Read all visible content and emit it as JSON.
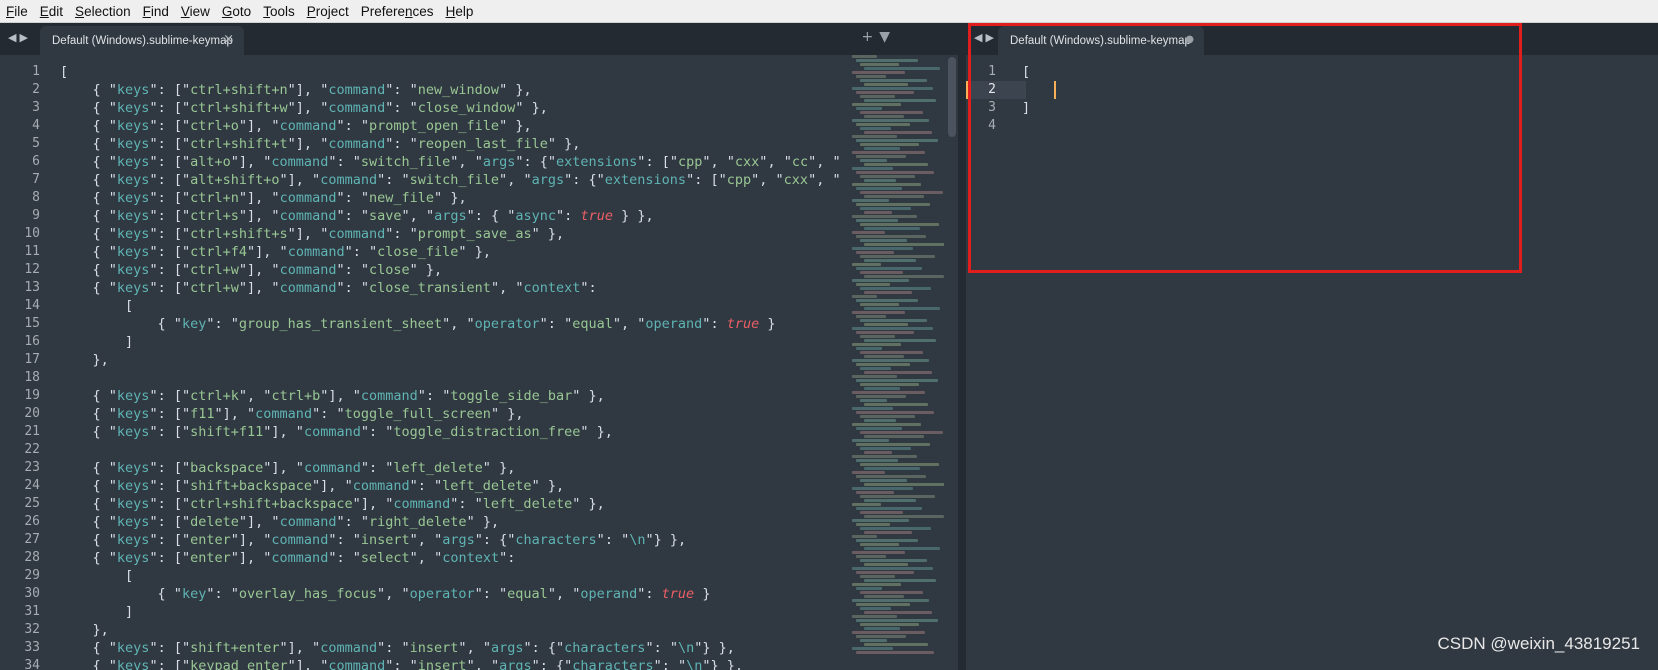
{
  "menu": [
    {
      "accel": "F",
      "rest": "ile"
    },
    {
      "accel": "E",
      "rest": "dit"
    },
    {
      "accel": "S",
      "rest": "election"
    },
    {
      "accel": "F",
      "rest": "ind"
    },
    {
      "accel": "V",
      "rest": "iew"
    },
    {
      "accel": "G",
      "rest": "oto"
    },
    {
      "accel": "T",
      "rest": "ools"
    },
    {
      "accel": "P",
      "rest": "roject"
    },
    {
      "pre": "Prefere",
      "accel": "n",
      "rest": "ces"
    },
    {
      "accel": "H",
      "rest": "elp"
    }
  ],
  "left_tab": {
    "label": "Default (Windows).sublime-keymap",
    "close": "×"
  },
  "right_tab": {
    "label": "Default (Windows).sublime-keymap",
    "dirty": "●"
  },
  "nav_arrows": "◀▶",
  "tab_tools": "+▼",
  "left_code": [
    "[",
    "\t{ \"keys\": [\"ctrl+shift+n\"], \"command\": \"new_window\" },",
    "\t{ \"keys\": [\"ctrl+shift+w\"], \"command\": \"close_window\" },",
    "\t{ \"keys\": [\"ctrl+o\"], \"command\": \"prompt_open_file\" },",
    "\t{ \"keys\": [\"ctrl+shift+t\"], \"command\": \"reopen_last_file\" },",
    "\t{ \"keys\": [\"alt+o\"], \"command\": \"switch_file\", \"args\": {\"extensions\": [\"cpp\", \"cxx\", \"cc\", \"",
    "\t{ \"keys\": [\"alt+shift+o\"], \"command\": \"switch_file\", \"args\": {\"extensions\": [\"cpp\", \"cxx\", \"",
    "\t{ \"keys\": [\"ctrl+n\"], \"command\": \"new_file\" },",
    "\t{ \"keys\": [\"ctrl+s\"], \"command\": \"save\", \"args\": { \"async\": true } },",
    "\t{ \"keys\": [\"ctrl+shift+s\"], \"command\": \"prompt_save_as\" },",
    "\t{ \"keys\": [\"ctrl+f4\"], \"command\": \"close_file\" },",
    "\t{ \"keys\": [\"ctrl+w\"], \"command\": \"close\" },",
    "\t{ \"keys\": [\"ctrl+w\"], \"command\": \"close_transient\", \"context\":",
    "\t\t[",
    "\t\t\t{ \"key\": \"group_has_transient_sheet\", \"operator\": \"equal\", \"operand\": true }",
    "\t\t]",
    "\t},",
    "",
    "\t{ \"keys\": [\"ctrl+k\", \"ctrl+b\"], \"command\": \"toggle_side_bar\" },",
    "\t{ \"keys\": [\"f11\"], \"command\": \"toggle_full_screen\" },",
    "\t{ \"keys\": [\"shift+f11\"], \"command\": \"toggle_distraction_free\" },",
    "",
    "\t{ \"keys\": [\"backspace\"], \"command\": \"left_delete\" },",
    "\t{ \"keys\": [\"shift+backspace\"], \"command\": \"left_delete\" },",
    "\t{ \"keys\": [\"ctrl+shift+backspace\"], \"command\": \"left_delete\" },",
    "\t{ \"keys\": [\"delete\"], \"command\": \"right_delete\" },",
    "\t{ \"keys\": [\"enter\"], \"command\": \"insert\", \"args\": {\"characters\": \"\\n\"} },",
    "\t{ \"keys\": [\"enter\"], \"command\": \"select\", \"context\":",
    "\t\t[",
    "\t\t\t{ \"key\": \"overlay_has_focus\", \"operator\": \"equal\", \"operand\": true }",
    "\t\t]",
    "\t},",
    "\t{ \"keys\": [\"shift+enter\"], \"command\": \"insert\", \"args\": {\"characters\": \"\\n\"} },",
    "\t{ \"keys\": [\"keypad_enter\"], \"command\": \"insert\", \"args\": {\"characters\": \"\\n\"} },"
  ],
  "right_code": [
    "[",
    "",
    "]",
    ""
  ],
  "active_right_line": 2,
  "watermark": "CSDN @weixin_43819251",
  "colors": {
    "background": "#303841",
    "string": "#99c794",
    "key": "#5fb4b4",
    "constant": "#ec5f66",
    "cursor": "#f9ae58",
    "highlight_box": "#e01e1e"
  }
}
